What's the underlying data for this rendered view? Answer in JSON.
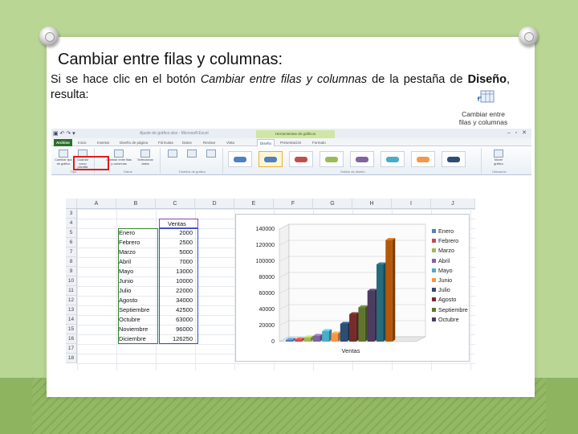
{
  "slide": {
    "title": "Cambiar entre filas y columnas:",
    "text_part1": "Si se hace clic en el botón ",
    "text_italic": "Cambiar entre filas y columnas",
    "text_part2": " de la pestaña de ",
    "text_bold": "Diseño",
    "text_part3": ", resulta:"
  },
  "button_preview": {
    "line1": "Cambiar entre",
    "line2": "filas y columnas",
    "icon": "switch-row-column-icon"
  },
  "excel": {
    "window_title": "Ajuste de gráfico.xlsx - Microsoft Excel",
    "context_tab_label": "Herramientas de gráficos",
    "tabs": [
      "Archivo",
      "Inicio",
      "Insertar",
      "Diseño de página",
      "Fórmulas",
      "Datos",
      "Revisar",
      "Vista",
      "Diseño",
      "Presentación",
      "Formato"
    ],
    "ribbon_buttons": {
      "change_type": "Cambiar tipo de gráfico",
      "save_template": "Guardar como plantilla",
      "switch": "Cambiar entre filas y columnas",
      "select_data": "Seleccionar datos",
      "move_chart": "Mover gráfico"
    },
    "ribbon_groups": {
      "type": "Tipo",
      "data": "Datos",
      "layouts": "Diseños de gráfico",
      "styles": "Estilos de diseño",
      "location": "Ubicación"
    },
    "columns": [
      "A",
      "B",
      "C",
      "D",
      "E",
      "F",
      "G",
      "H",
      "I",
      "J"
    ],
    "rows": [
      "3",
      "4",
      "5",
      "6",
      "7",
      "8",
      "9",
      "10",
      "11",
      "12",
      "13",
      "14",
      "15",
      "16",
      "17",
      "18"
    ],
    "header_ventas": "Ventas",
    "table": [
      {
        "mes": "Enero",
        "valor": "2000"
      },
      {
        "mes": "Febrero",
        "valor": "2500"
      },
      {
        "mes": "Marzo",
        "valor": "5000"
      },
      {
        "mes": "Abril",
        "valor": "7000"
      },
      {
        "mes": "Mayo",
        "valor": "13000"
      },
      {
        "mes": "Junio",
        "valor": "10000"
      },
      {
        "mes": "Julio",
        "valor": "22000"
      },
      {
        "mes": "Agosto",
        "valor": "34000"
      },
      {
        "mes": "Septiembre",
        "valor": "42500"
      },
      {
        "mes": "Octubre",
        "valor": "63000"
      },
      {
        "mes": "Noviembre",
        "valor": "96000"
      },
      {
        "mes": "Diciembre",
        "valor": "126250"
      }
    ]
  },
  "chart_data": {
    "type": "bar",
    "title": "",
    "xlabel": "Ventas",
    "ylabel": "",
    "categories": [
      "Ventas"
    ],
    "ylim": [
      0,
      140000
    ],
    "yticks": [
      "0",
      "20000",
      "40000",
      "60000",
      "80000",
      "100000",
      "120000",
      "140000"
    ],
    "series": [
      {
        "name": "Enero",
        "values": [
          2000
        ]
      },
      {
        "name": "Febrero",
        "values": [
          2500
        ]
      },
      {
        "name": "Marzo",
        "values": [
          5000
        ]
      },
      {
        "name": "Abril",
        "values": [
          7000
        ]
      },
      {
        "name": "Mayo",
        "values": [
          13000
        ]
      },
      {
        "name": "Junio",
        "values": [
          10000
        ]
      },
      {
        "name": "Julio",
        "values": [
          22000
        ]
      },
      {
        "name": "Agosto",
        "values": [
          34000
        ]
      },
      {
        "name": "Septiembre",
        "values": [
          42500
        ]
      },
      {
        "name": "Octubre",
        "values": [
          63000
        ]
      },
      {
        "name": "Noviembre",
        "values": [
          96000
        ]
      },
      {
        "name": "Diciembre",
        "values": [
          126250
        ]
      }
    ],
    "legend_visible": [
      "Enero",
      "Febrero",
      "Marzo",
      "Abril",
      "Mayo",
      "Junio",
      "Julio",
      "Agosto",
      "Septiembre",
      "Octubre"
    ],
    "colors": [
      "#4f81bd",
      "#c0504d",
      "#9bbb59",
      "#8064a2",
      "#4bacc6",
      "#f79646",
      "#2c4d75",
      "#772c2a",
      "#5f7530",
      "#4d3b62",
      "#276a7c",
      "#b65708"
    ],
    "legend_position": "right",
    "style": "3d-clustered-column"
  }
}
